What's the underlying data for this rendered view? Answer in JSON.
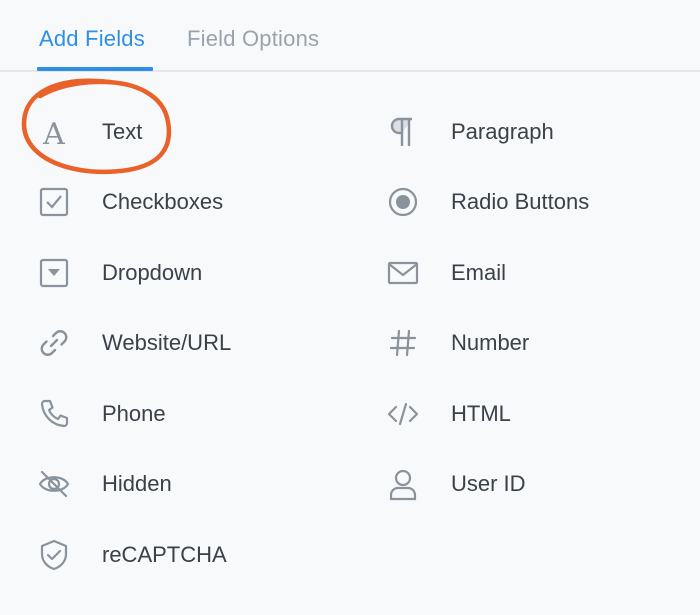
{
  "tabs": {
    "add_fields": "Add Fields",
    "field_options": "Field Options"
  },
  "colors": {
    "accent": "#2f8fe6",
    "inactive_tab": "#9aa3ad",
    "icon": "#8a939c",
    "label": "#3a4149",
    "highlight_circle": "#e8622a"
  },
  "fields": [
    {
      "label": "Text",
      "icon": "text-icon"
    },
    {
      "label": "Paragraph",
      "icon": "paragraph-icon"
    },
    {
      "label": "Checkboxes",
      "icon": "checkbox-icon"
    },
    {
      "label": "Radio Buttons",
      "icon": "radio-icon"
    },
    {
      "label": "Dropdown",
      "icon": "dropdown-icon"
    },
    {
      "label": "Email",
      "icon": "email-icon"
    },
    {
      "label": "Website/URL",
      "icon": "link-icon"
    },
    {
      "label": "Number",
      "icon": "hash-icon"
    },
    {
      "label": "Phone",
      "icon": "phone-icon"
    },
    {
      "label": "HTML",
      "icon": "code-icon"
    },
    {
      "label": "Hidden",
      "icon": "eye-off-icon"
    },
    {
      "label": "User ID",
      "icon": "user-icon"
    },
    {
      "label": "reCAPTCHA",
      "icon": "shield-check-icon"
    }
  ]
}
